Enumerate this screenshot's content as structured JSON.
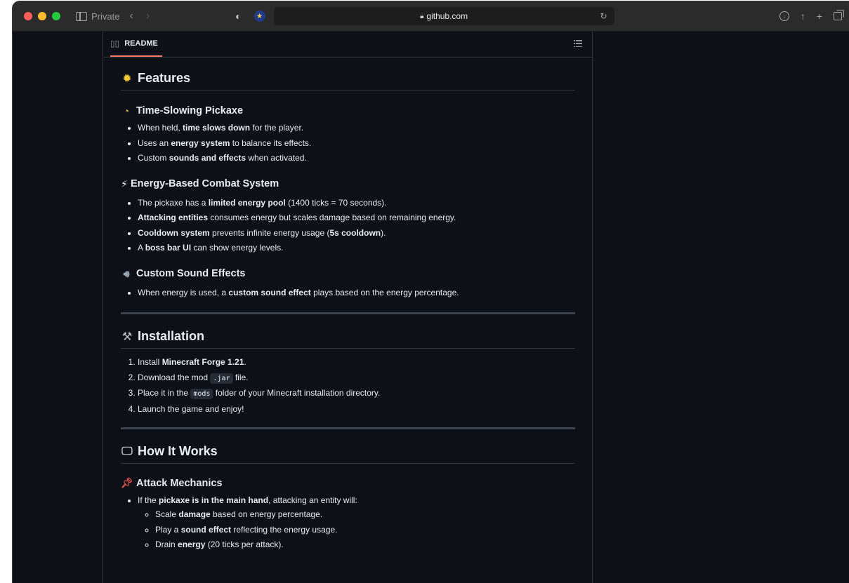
{
  "browser": {
    "private_label": "Private",
    "url": "github.com"
  },
  "readme": {
    "tab_label": "README"
  },
  "features": {
    "heading": "Features",
    "pickaxe": {
      "heading": "Time-Slowing Pickaxe",
      "items": [
        [
          "When held, ",
          "time slows down",
          " for the player."
        ],
        [
          "Uses an ",
          "energy system",
          " to balance its effects."
        ],
        [
          "Custom ",
          "sounds and effects",
          " when activated."
        ]
      ]
    },
    "combat": {
      "heading": "Energy-Based Combat System",
      "items": [
        [
          "The pickaxe has a ",
          "limited energy pool",
          " (1400 ticks = 70 seconds)."
        ],
        [
          "",
          "Attacking entities",
          " consumes energy but scales damage based on remaining energy."
        ],
        [
          "",
          "Cooldown system",
          " prevents infinite energy usage (",
          "5s cooldown",
          ")."
        ],
        [
          "A ",
          "boss bar UI",
          " can show energy levels."
        ]
      ]
    },
    "sound": {
      "heading": "Custom Sound Effects",
      "items": [
        [
          "When energy is used, a ",
          "custom sound effect",
          " plays based on the energy percentage."
        ]
      ]
    }
  },
  "installation": {
    "heading": "Installation",
    "step1": [
      "Install ",
      "Minecraft Forge 1.21",
      "."
    ],
    "step2": [
      "Download the mod ",
      ".jar",
      " file."
    ],
    "step3": [
      "Place it in the ",
      "mods",
      " folder of your Minecraft installation directory."
    ],
    "step4": "Launch the game and enjoy!"
  },
  "how": {
    "heading": "How It Works",
    "attack": {
      "heading": "Attack Mechanics",
      "intro": [
        "If the ",
        "pickaxe is in the main hand",
        ", attacking an entity will:"
      ],
      "sub": [
        [
          "Scale ",
          "damage",
          " based on energy percentage."
        ],
        [
          "Play a ",
          "sound effect",
          " reflecting the energy usage."
        ],
        [
          "Drain ",
          "energy",
          " (20 ticks per attack)."
        ]
      ]
    }
  }
}
